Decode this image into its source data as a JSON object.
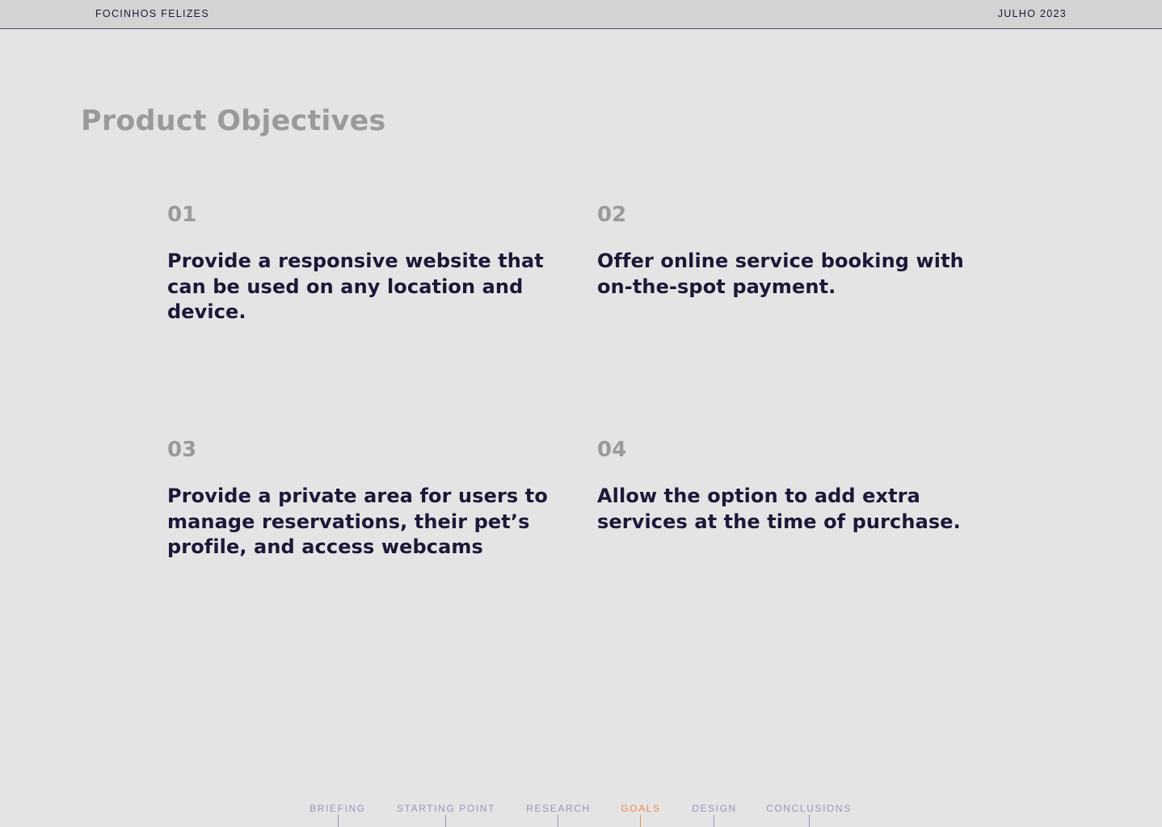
{
  "header": {
    "brand": "FOCINHOS FELIZES",
    "date": "JULHO 2023"
  },
  "page": {
    "title": "Product Objectives"
  },
  "objectives": [
    {
      "number": "01",
      "text": "Provide a responsive website that can be used on any location and device."
    },
    {
      "number": "02",
      "text": "Offer online service booking with on-the-spot payment."
    },
    {
      "number": "03",
      "text": "Provide a private area for users to manage reservations, their pet’s profile, and access webcams"
    },
    {
      "number": "04",
      "text": "Allow the option to add extra services at the time of purchase."
    }
  ],
  "nav": {
    "items": [
      {
        "label": "BRIEFING",
        "active": false
      },
      {
        "label": "STARTING POINT",
        "active": false
      },
      {
        "label": "RESEARCH",
        "active": false
      },
      {
        "label": "GOALS",
        "active": true
      },
      {
        "label": "DESIGN",
        "active": false
      },
      {
        "label": "CONCLUSIONS",
        "active": false
      }
    ]
  },
  "colors": {
    "background": "#e4e4e4",
    "header_bg": "#d3d3d3",
    "dark_navy": "#1c1838",
    "muted_gray": "#9a9a9a",
    "nav_inactive": "#9895b8",
    "nav_active": "#ef8a4c"
  }
}
